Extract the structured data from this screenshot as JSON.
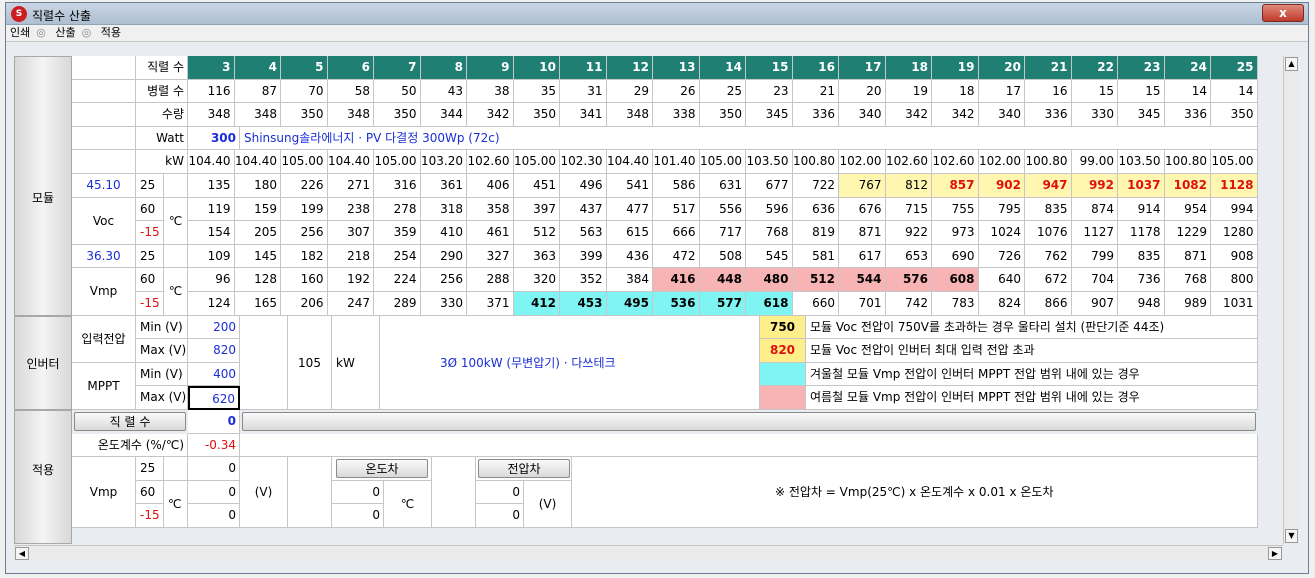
{
  "window": {
    "title": "직렬수 산출",
    "close": "x"
  },
  "menu": [
    "인쇄",
    "산출",
    "적용"
  ],
  "labels": {
    "series": "직렬 수",
    "parallel": "병렬 수",
    "qty": "수량",
    "watt": "Watt",
    "kw": "kW",
    "module": "모듈",
    "voc": "Voc",
    "vmp": "Vmp",
    "celsius": "℃",
    "inverter": "인버터",
    "input_voltage": "입력전압",
    "mppt": "MPPT",
    "min_v": "Min (V)",
    "max_v": "Max (V)",
    "apply": "적용",
    "series_btn": "직 렬 수",
    "temp_coef": "온도계수 (%/℃)",
    "temp_diff_btn": "온도차",
    "volt_diff_btn": "전압차",
    "v_unit": "(V)",
    "kw_unit": "kW",
    "formula": "※ 전압차 = Vmp(25℃) x 온도계수 x 0.01 x 온도차"
  },
  "series": [
    "3",
    "4",
    "5",
    "6",
    "7",
    "8",
    "9",
    "10",
    "11",
    "12",
    "13",
    "14",
    "15",
    "16",
    "17",
    "18",
    "19",
    "20",
    "21",
    "22",
    "23",
    "24",
    "25"
  ],
  "parallel": [
    "116",
    "87",
    "70",
    "58",
    "50",
    "43",
    "38",
    "35",
    "31",
    "29",
    "26",
    "25",
    "23",
    "21",
    "20",
    "19",
    "18",
    "17",
    "16",
    "15",
    "15",
    "14",
    "14"
  ],
  "qty": [
    "348",
    "348",
    "350",
    "348",
    "350",
    "344",
    "342",
    "350",
    "341",
    "348",
    "338",
    "350",
    "345",
    "336",
    "340",
    "342",
    "342",
    "340",
    "336",
    "330",
    "345",
    "336",
    "350"
  ],
  "watt": {
    "value": "300",
    "desc": "Shinsung솔라에너지 ·  PV 다결정 300Wp (72c)"
  },
  "kw": [
    "104.40",
    "104.40",
    "105.00",
    "104.40",
    "105.00",
    "103.20",
    "102.60",
    "105.00",
    "102.30",
    "104.40",
    "101.40",
    "105.00",
    "103.50",
    "100.80",
    "102.00",
    "102.60",
    "102.60",
    "102.00",
    "100.80",
    "99.00",
    "103.50",
    "100.80",
    "105.00"
  ],
  "voc": {
    "value": "45.10",
    "temps": [
      "25",
      "60",
      "-15"
    ],
    "rows": [
      [
        "135",
        "180",
        "226",
        "271",
        "316",
        "361",
        "406",
        "451",
        "496",
        "541",
        "586",
        "631",
        "677",
        "722",
        "767",
        "812",
        "857",
        "902",
        "947",
        "992",
        "1037",
        "1082",
        "1128"
      ],
      [
        "119",
        "159",
        "199",
        "238",
        "278",
        "318",
        "358",
        "397",
        "437",
        "477",
        "517",
        "556",
        "596",
        "636",
        "676",
        "715",
        "755",
        "795",
        "835",
        "874",
        "914",
        "954",
        "994"
      ],
      [
        "154",
        "205",
        "256",
        "307",
        "359",
        "410",
        "461",
        "512",
        "563",
        "615",
        "666",
        "717",
        "768",
        "819",
        "871",
        "922",
        "973",
        "1024",
        "1076",
        "1127",
        "1178",
        "1229",
        "1280"
      ]
    ]
  },
  "vmp": {
    "value": "36.30",
    "temps": [
      "25",
      "60",
      "-15"
    ],
    "rows": [
      [
        "109",
        "145",
        "182",
        "218",
        "254",
        "290",
        "327",
        "363",
        "399",
        "436",
        "472",
        "508",
        "545",
        "581",
        "617",
        "653",
        "690",
        "726",
        "762",
        "799",
        "835",
        "871",
        "908"
      ],
      [
        "96",
        "128",
        "160",
        "192",
        "224",
        "256",
        "288",
        "320",
        "352",
        "384",
        "416",
        "448",
        "480",
        "512",
        "544",
        "576",
        "608",
        "640",
        "672",
        "704",
        "736",
        "768",
        "800"
      ],
      [
        "124",
        "165",
        "206",
        "247",
        "289",
        "330",
        "371",
        "412",
        "453",
        "495",
        "536",
        "577",
        "618",
        "660",
        "701",
        "742",
        "783",
        "824",
        "866",
        "907",
        "948",
        "989",
        "1031"
      ]
    ]
  },
  "inverter": {
    "input_min": "200",
    "input_max": "820",
    "mppt_min": "400",
    "mppt_max": "620",
    "capacity": "105",
    "desc": "3Ø 100kW (무변압기) · 다쓰테크"
  },
  "legend": [
    {
      "value": "750",
      "text": "모듈 Voc 전압이 750V를 초과하는 경우 울타리 설치 (판단기준 44조)"
    },
    {
      "value": "820",
      "text": "모듈 Voc 전압이 인버터 최대 입력 전압 초과"
    },
    {
      "value": "",
      "text": "겨울철 모듈 Vmp 전압이 인버터 MPPT 전압 범위 내에 있는 경우"
    },
    {
      "value": "",
      "text": "여름철 모듈 Vmp 전압이 인버터 MPPT 전압 범위 내에 있는 경우"
    }
  ],
  "apply": {
    "series_value": "0",
    "temp_coef": "-0.34",
    "temps": [
      "25",
      "60",
      "-15"
    ],
    "vmp_vals": [
      "0",
      "0",
      "0"
    ],
    "temp_diff": [
      "0",
      "0"
    ],
    "volt_diff": [
      "0",
      "0"
    ]
  },
  "colors": {
    "header": "#1f7f73",
    "yellow": "#fff7b0",
    "pink": "#f8b4b4",
    "cyan": "#7ff5f3"
  }
}
